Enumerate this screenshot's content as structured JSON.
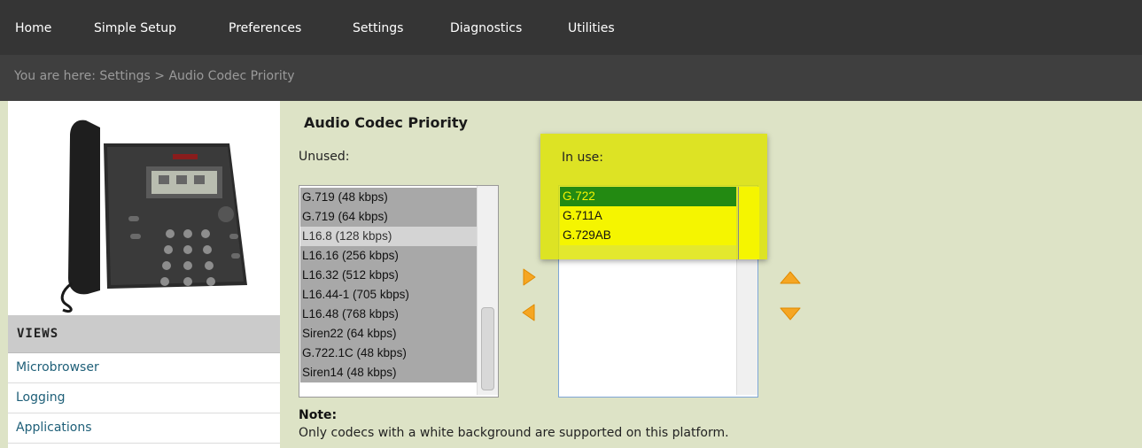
{
  "nav": {
    "items": [
      {
        "label": "Home"
      },
      {
        "label": "Simple Setup"
      },
      {
        "label": "Preferences"
      },
      {
        "label": "Settings"
      },
      {
        "label": "Diagnostics"
      },
      {
        "label": "Utilities"
      }
    ]
  },
  "breadcrumb": "You are here: Settings > Audio Codec Priority",
  "sidebar": {
    "views_header": "VIEWS",
    "links": [
      {
        "label": "Microbrowser"
      },
      {
        "label": "Logging"
      },
      {
        "label": "Applications"
      }
    ]
  },
  "main": {
    "title": "Audio Codec Priority",
    "unused_label": "Unused:",
    "unused_items": [
      {
        "label": "G.719 (48 kbps)"
      },
      {
        "label": "G.719 (64 kbps)"
      },
      {
        "label": "L16.8 (128 kbps)"
      },
      {
        "label": "L16.16 (256 kbps)"
      },
      {
        "label": "L16.32 (512 kbps)"
      },
      {
        "label": "L16.44-1 (705 kbps)"
      },
      {
        "label": "L16.48 (768 kbps)"
      },
      {
        "label": "Siren22 (64 kbps)"
      },
      {
        "label": "G.722.1C (48 kbps)"
      },
      {
        "label": "Siren14 (48 kbps)"
      }
    ],
    "inuse_label": "In use:",
    "inuse_items": [
      {
        "label": "G.722"
      },
      {
        "label": "G.711A"
      },
      {
        "label": "G.729AB"
      }
    ],
    "note_title": "Note:",
    "note_text": "Only codecs with a white background are supported on this platform."
  },
  "colors": {
    "nav_bg": "#353535",
    "breadcrumb_bg": "#3f3f3f",
    "content_bg": "#dde3c6",
    "arrow_orange": "#f5a623",
    "highlight_yellow": "#dde300",
    "selected_green": "#238a12"
  },
  "icons": [
    "move-right-arrow-icon",
    "move-left-arrow-icon",
    "move-up-arrow-icon",
    "move-down-arrow-icon",
    "desk-phone-image"
  ]
}
